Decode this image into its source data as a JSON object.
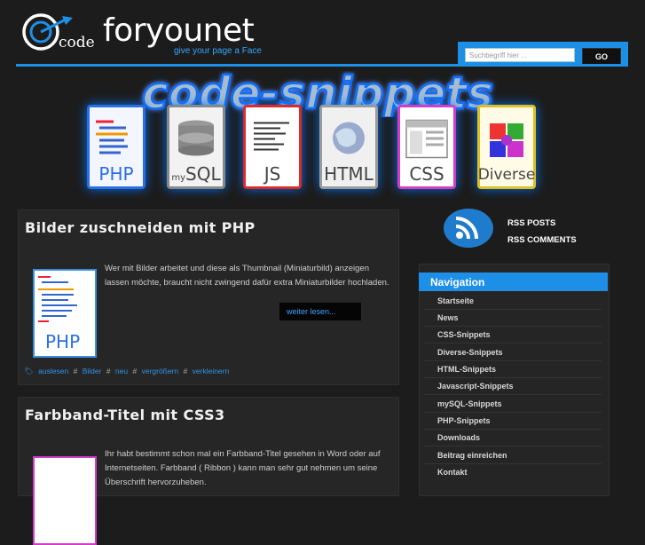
{
  "header": {
    "logo_word": "foryounet",
    "logo_code": "code",
    "tagline": "give your page a Face",
    "accent_color": "#1e8fe6"
  },
  "search": {
    "placeholder": "Suchbegriff hier ...",
    "button_label": "GO"
  },
  "banner": {
    "title": "code-snippets",
    "tiles": [
      {
        "label": "PHP",
        "border": "#2a6ee8",
        "icon": "php-snippet-icon"
      },
      {
        "label": "SQL",
        "prefix": "my",
        "border": "#888888",
        "icon": "database-icon"
      },
      {
        "label": "JS",
        "border": "#e02828",
        "icon": "js-snippet-icon"
      },
      {
        "label": "HTML",
        "border": "#9a9a9a",
        "icon": "globe-icon"
      },
      {
        "label": "CSS",
        "border": "#d43cc8",
        "icon": "css-snippet-icon"
      },
      {
        "label": "Diverse",
        "border": "#e0c020",
        "icon": "puzzle-icon"
      }
    ]
  },
  "posts": [
    {
      "title": "Bilder zuschneiden mit PHP",
      "text": "Wer mit Bilder arbeitet und diese als Thumbnail (Miniaturbild) anzeigen lassen möchte, braucht nicht zwingend dafür extra Miniaturbilder hochladen.",
      "read_more": "weiter lesen...",
      "thumb_label": "PHP",
      "tags": [
        "auslesen",
        "Bilder",
        "neu",
        "vergrößern",
        "verkleinern"
      ]
    },
    {
      "title": "Farbband-Titel mit CSS3",
      "text": "Ihr habt bestimmt schon mal ein Farbband-Titel gesehen in Word oder auf Internetseiten. Farbband ( Ribbon ) kann man sehr gut nehmen um seine Überschrift hervorzuheben."
    }
  ],
  "sidebar": {
    "rss_posts": "RSS POSTS",
    "rss_comments": "RSS COMMENTS",
    "nav_title": "Navigation",
    "nav_items": [
      "Startseite",
      "News",
      "CSS-Snippets",
      "Diverse-Snippets",
      "HTML-Snippets",
      "Javascript-Snippets",
      "mySQL-Snippets",
      "PHP-Snippets",
      "Downloads",
      "Beitrag einreichen",
      "Kontakt"
    ]
  }
}
